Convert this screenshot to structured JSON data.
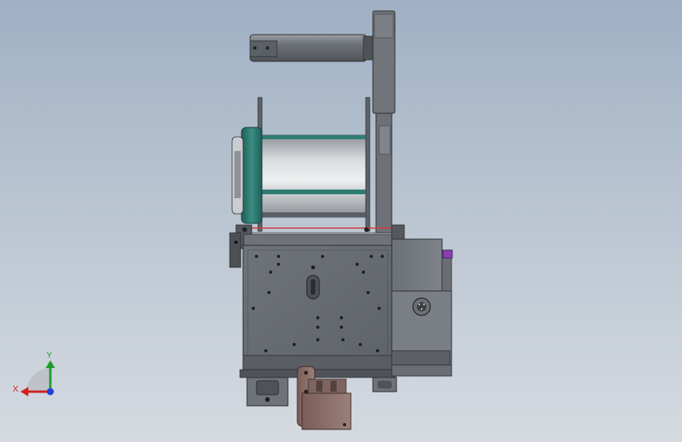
{
  "viewport": {
    "background_top": "#9fb0c4",
    "background_bottom": "#d5dae0"
  },
  "model": {
    "parts": [
      "top-roller",
      "back-plate",
      "label-reel",
      "reel-flange",
      "reel-core",
      "side-frame",
      "label-path-line",
      "main-body-plate",
      "adjustment-slot",
      "motor-housing",
      "connector-socket",
      "mounting-bracket",
      "bottom-clamp-left",
      "bottom-clamp-right",
      "status-led"
    ],
    "colors": {
      "steel": "#7a7f86",
      "dark_steel": "#55595f",
      "reel_teal": "#2e7c72",
      "bracket_copper": "#8b6f6a",
      "label_line": "#d23a3a",
      "led_purple": "#8a3fb4"
    }
  },
  "triad": {
    "x_label": "X",
    "y_label": "Y",
    "x_color": "#d32020",
    "y_color": "#1f9d2b",
    "z_color": "#2340d8"
  }
}
